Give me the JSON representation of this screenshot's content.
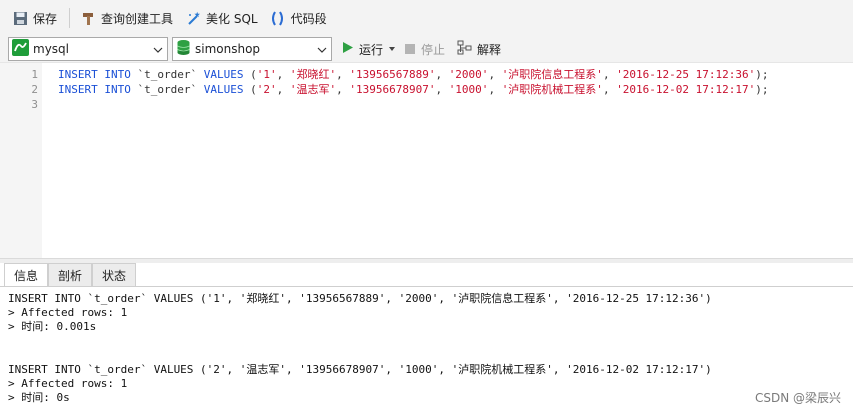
{
  "toolbar": {
    "save_label": "保存",
    "query_builder_label": "查询创建工具",
    "beautify_label": "美化 SQL",
    "snippet_label": "代码段"
  },
  "connection": {
    "database": "mysql",
    "schema": "simonshop"
  },
  "actions": {
    "run_label": "运行",
    "stop_label": "停止",
    "explain_label": "解释"
  },
  "editor": {
    "line_numbers": [
      "1",
      "2",
      "3"
    ],
    "lines": [
      {
        "kw1": "INSERT INTO",
        "tbl": " `t_order` ",
        "kw2": "VALUES",
        "open": " (",
        "v1": "'1'",
        "c1": ", ",
        "v2": "'郑晓红'",
        "c2": ", ",
        "v3": "'13956567889'",
        "c3": ", ",
        "v4": "'2000'",
        "c4": ", ",
        "v5": "'泸职院信息工程系'",
        "c5": ", ",
        "v6": "'2016-12-25 17:12:36'",
        "close": ");"
      },
      {
        "kw1": "INSERT INTO",
        "tbl": " `t_order` ",
        "kw2": "VALUES",
        "open": " (",
        "v1": "'2'",
        "c1": ", ",
        "v2": "'温志军'",
        "c2": ", ",
        "v3": "'13956678907'",
        "c3": ", ",
        "v4": "'1000'",
        "c4": ", ",
        "v5": "'泸职院机械工程系'",
        "c5": ", ",
        "v6": "'2016-12-02 17:12:17'",
        "close": ");"
      }
    ]
  },
  "tabs": [
    {
      "label": "信息"
    },
    {
      "label": "剖析"
    },
    {
      "label": "状态"
    }
  ],
  "results": [
    "INSERT INTO `t_order` VALUES ('1', '郑晓红', '13956567889', '2000', '泸职院信息工程系', '2016-12-25 17:12:36')",
    "> Affected rows: 1",
    "> 时间: 0.001s",
    "INSERT INTO `t_order` VALUES ('2', '温志军', '13956678907', '1000', '泸职院机械工程系', '2016-12-02 17:12:17')",
    "> Affected rows: 1",
    "> 时间: 0s"
  ],
  "watermark": "CSDN @梁辰兴",
  "colors": {
    "keyword": "#1a4fd6",
    "string": "#c8102e",
    "run_green": "#2ea043"
  }
}
